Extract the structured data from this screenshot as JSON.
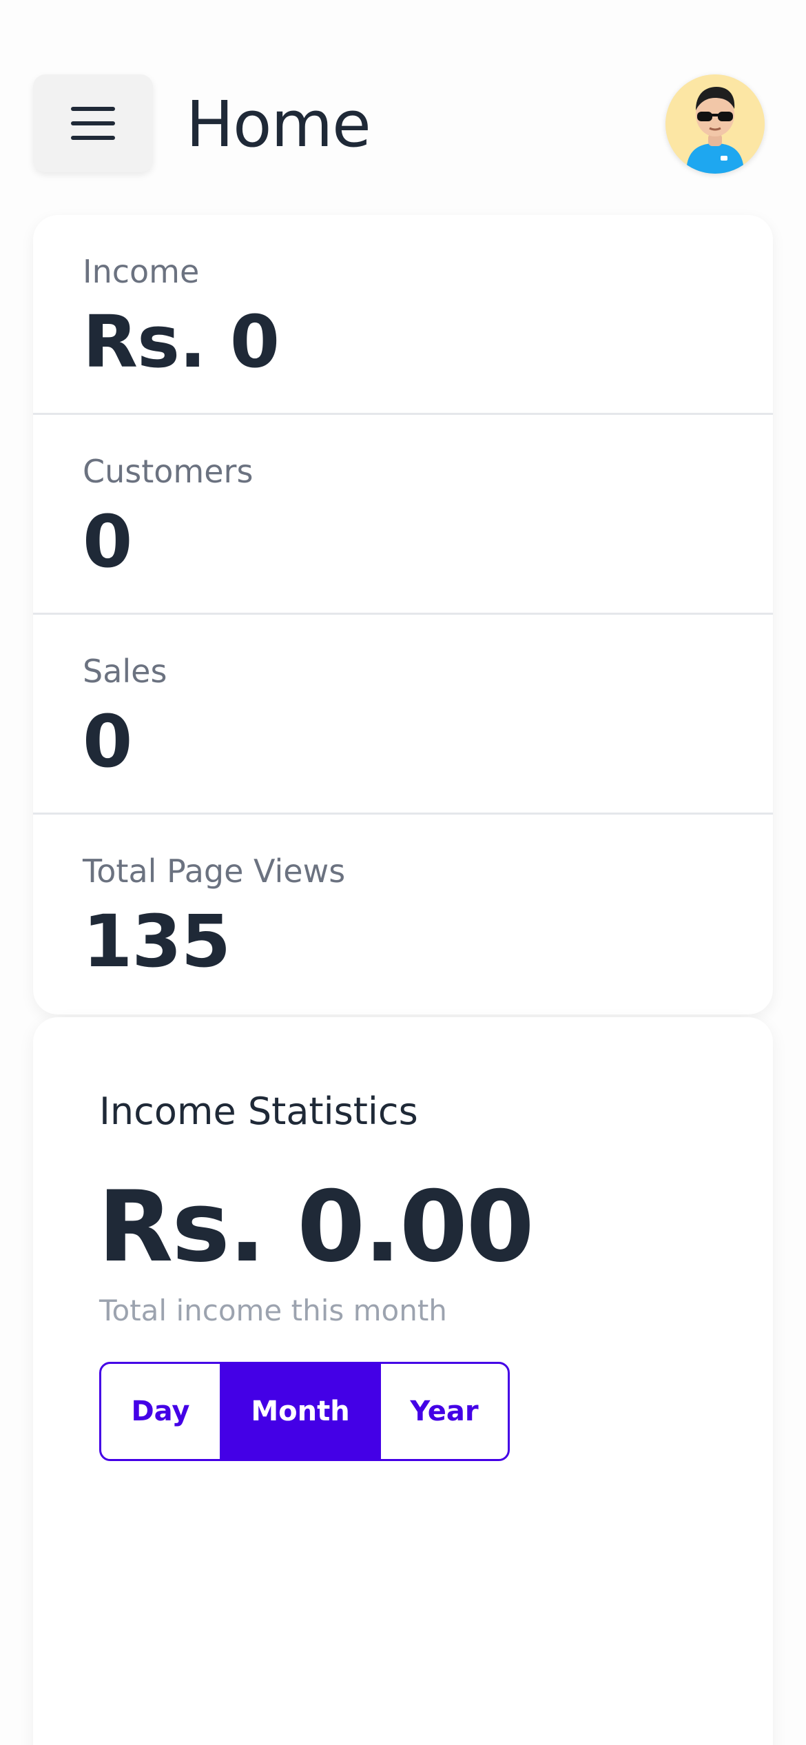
{
  "header": {
    "menu_icon": "hamburger-menu-icon",
    "title": "Home",
    "avatar_icon": "user-avatar-icon"
  },
  "stats": [
    {
      "label": "Income",
      "value": "Rs. 0"
    },
    {
      "label": "Customers",
      "value": "0"
    },
    {
      "label": "Sales",
      "value": "0"
    },
    {
      "label": "Total Page Views",
      "value": "135"
    }
  ],
  "income_statistics": {
    "title": "Income Statistics",
    "amount": "Rs. 0.00",
    "caption": "Total income this month",
    "periods": [
      "Day",
      "Month",
      "Year"
    ],
    "selected_period": "Month"
  },
  "colors": {
    "accent": "#4400e6",
    "text_primary": "#1f2937",
    "text_muted": "#6b7280",
    "avatar_bg": "#fce6a4"
  }
}
